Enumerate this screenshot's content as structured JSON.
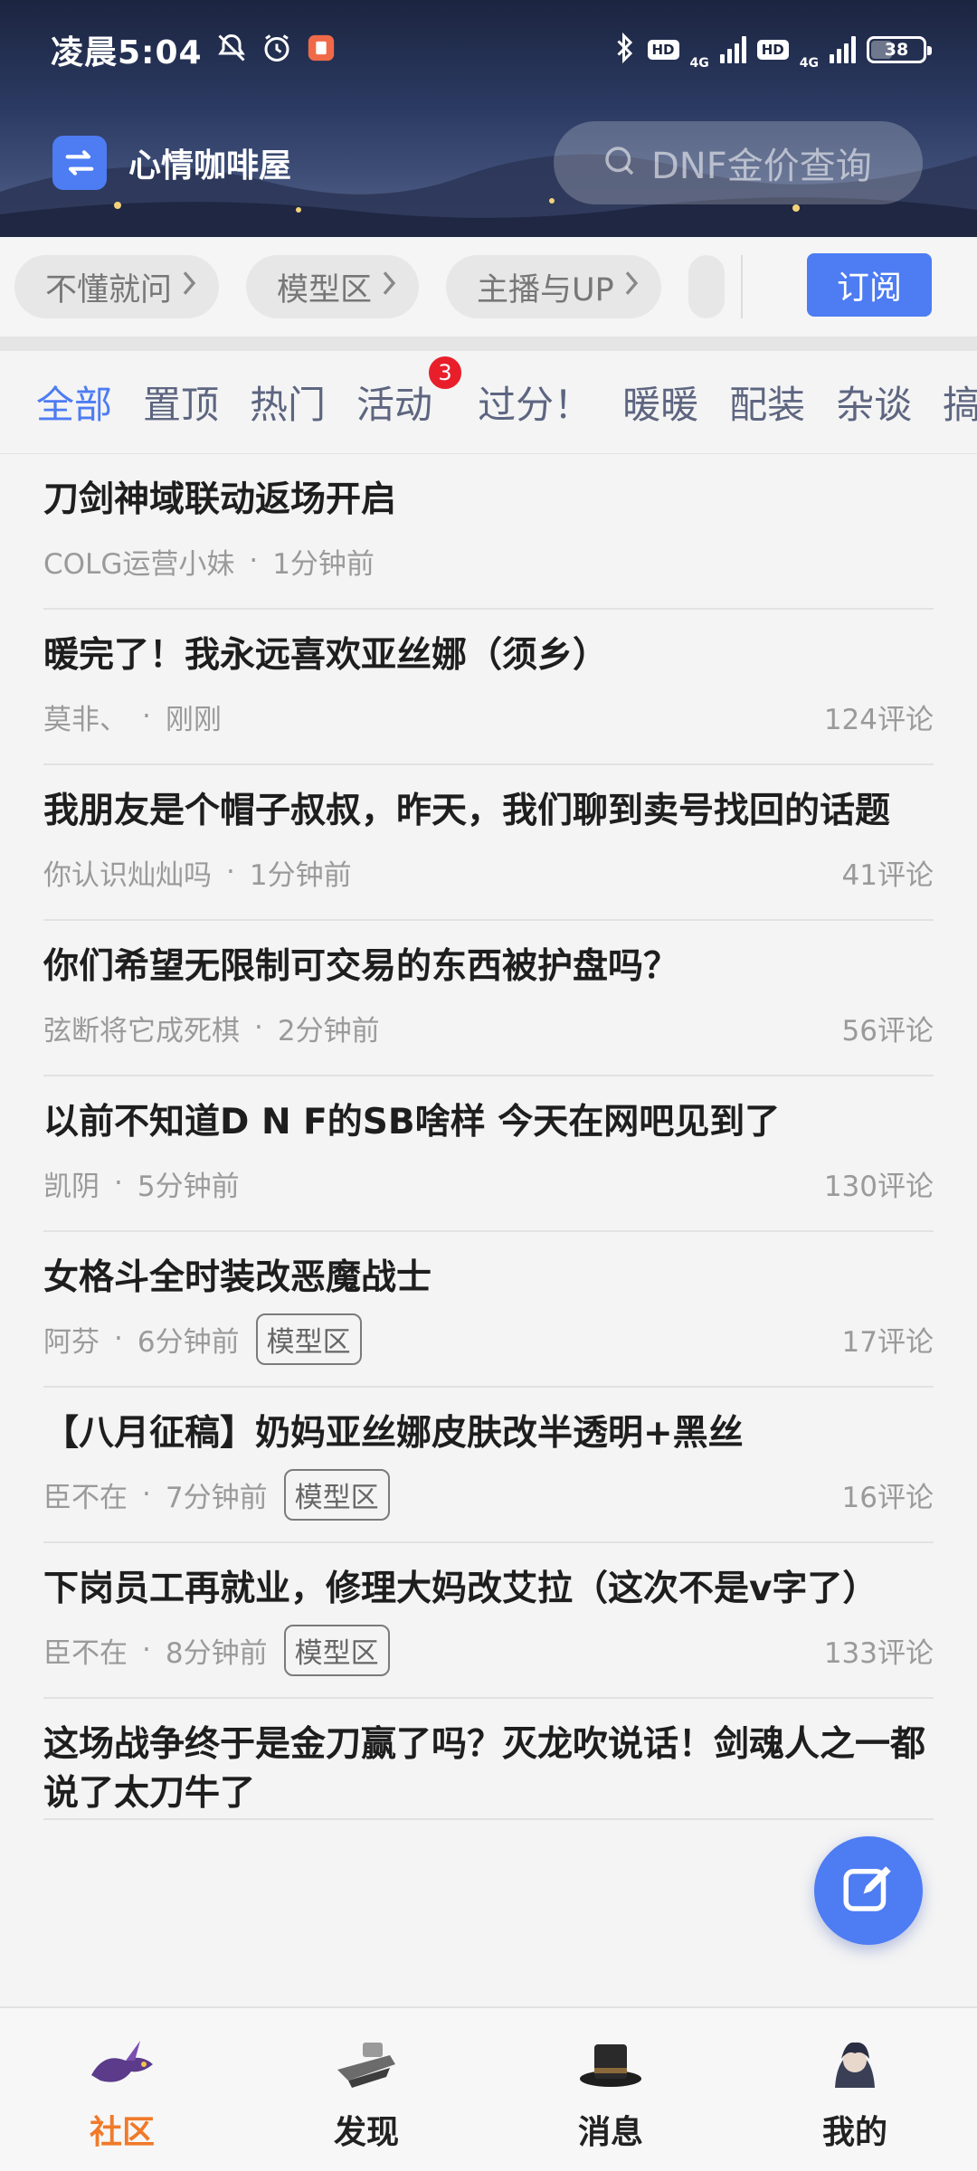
{
  "status_bar": {
    "time": "凌晨5:04",
    "hd_1": "HD",
    "network_1": "4G",
    "hd_2": "HD",
    "network_2": "4G",
    "battery": "38",
    "battery_level": 0.38
  },
  "app_bar": {
    "title": "心情咖啡屋",
    "search_placeholder": "DNF金价查询"
  },
  "chips": [
    {
      "label": "不懂就问"
    },
    {
      "label": "模型区"
    },
    {
      "label": "主播与UP"
    }
  ],
  "subscribe_label": "订阅",
  "tabs": [
    {
      "label": "全部",
      "active": true
    },
    {
      "label": "置顶"
    },
    {
      "label": "热门"
    },
    {
      "label": "活动",
      "badge": "3"
    },
    {
      "label": "过分！"
    },
    {
      "label": "暖暖"
    },
    {
      "label": "配装"
    },
    {
      "label": "杂谈"
    },
    {
      "label": "搞"
    }
  ],
  "posts": [
    {
      "title": "刀剑神域联动返场开启",
      "author": "COLG运营小妹",
      "time": "1分钟前",
      "tag": "",
      "comments": ""
    },
    {
      "title": "暖完了！我永远喜欢亚丝娜（须乡）",
      "author": "莫非、",
      "time": "刚刚",
      "tag": "",
      "comments": "124评论"
    },
    {
      "title": "我朋友是个帽子叔叔，昨天，我们聊到卖号找回的话题",
      "author": "你认识灿灿吗",
      "time": "1分钟前",
      "tag": "",
      "comments": "41评论"
    },
    {
      "title": "你们希望无限制可交易的东西被护盘吗？",
      "author": "弦断将它成死棋",
      "time": "2分钟前",
      "tag": "",
      "comments": "56评论"
    },
    {
      "title": "以前不知道D N F的SB啥样 今天在网吧见到了",
      "author": "凯阴",
      "time": "5分钟前",
      "tag": "",
      "comments": "130评论"
    },
    {
      "title": "女格斗全时装改恶魔战士",
      "author": "阿芬",
      "time": "6分钟前",
      "tag": "模型区",
      "comments": "17评论"
    },
    {
      "title": "【八月征稿】奶妈亚丝娜皮肤改半透明+黑丝",
      "author": "臣不在",
      "time": "7分钟前",
      "tag": "模型区",
      "comments": "16评论"
    },
    {
      "title": "下岗员工再就业，修理大妈改艾拉（这次不是v字了）",
      "author": "臣不在",
      "time": "8分钟前",
      "tag": "模型区",
      "comments": "133评论"
    },
    {
      "title": "这场战争终于是金刀赢了吗？灭龙吹说话！剑魂人之一都说了太刀牛了",
      "author": "",
      "time": "",
      "tag": "",
      "comments": ""
    }
  ],
  "bottom_nav": [
    {
      "label": "社区",
      "active": true
    },
    {
      "label": "发现"
    },
    {
      "label": "消息"
    },
    {
      "label": "我的"
    }
  ],
  "meta_separator": "·",
  "colors": {
    "accent": "#4d7cf3",
    "nav_active": "#f07a2a",
    "badge": "#e81f2b"
  }
}
